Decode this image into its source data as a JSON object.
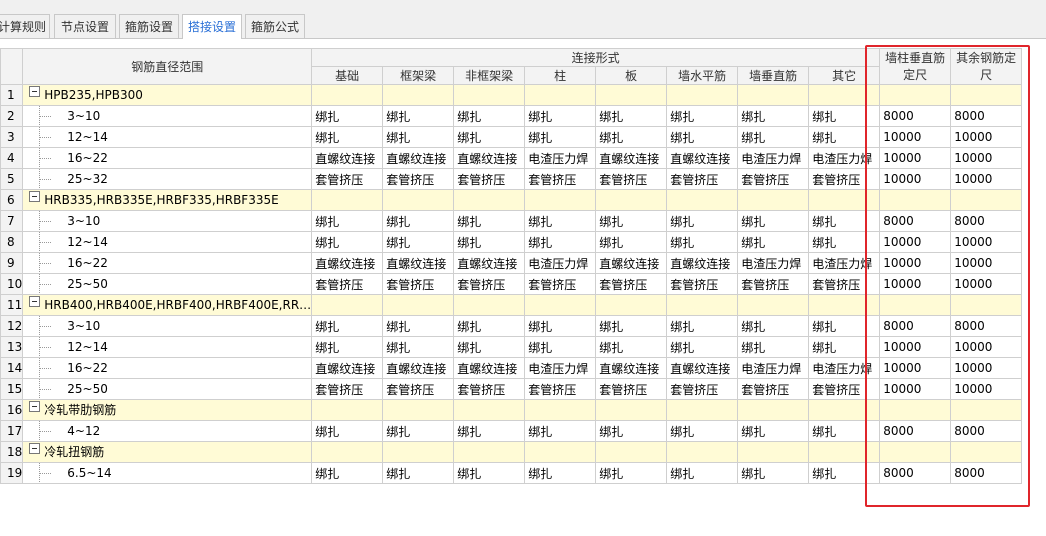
{
  "tabs": [
    {
      "label": "计算规则",
      "active": false
    },
    {
      "label": "节点设置",
      "active": false
    },
    {
      "label": "箍筋设置",
      "active": false
    },
    {
      "label": "搭接设置",
      "active": true
    },
    {
      "label": "箍筋公式",
      "active": false
    }
  ],
  "header": {
    "range": "钢筋直径范围",
    "connection_group": "连接形式",
    "connection_cols": [
      "基础",
      "框架梁",
      "非框架梁",
      "柱",
      "板",
      "墙水平筋",
      "墙垂直筋",
      "其它"
    ],
    "fixed_wall": "墙柱垂直筋定尺",
    "fixed_other": "其余钢筋定尺"
  },
  "rows": [
    {
      "n": "1",
      "type": "cat",
      "label": "HPB235,HPB300"
    },
    {
      "n": "2",
      "type": "data",
      "label": "3~10",
      "c": [
        "绑扎",
        "绑扎",
        "绑扎",
        "绑扎",
        "绑扎",
        "绑扎",
        "绑扎",
        "绑扎"
      ],
      "f1": "8000",
      "f2": "8000"
    },
    {
      "n": "3",
      "type": "data",
      "label": "12~14",
      "c": [
        "绑扎",
        "绑扎",
        "绑扎",
        "绑扎",
        "绑扎",
        "绑扎",
        "绑扎",
        "绑扎"
      ],
      "f1": "10000",
      "f2": "10000"
    },
    {
      "n": "4",
      "type": "data",
      "label": "16~22",
      "c": [
        "直螺纹连接",
        "直螺纹连接",
        "直螺纹连接",
        "电渣压力焊",
        "直螺纹连接",
        "直螺纹连接",
        "电渣压力焊",
        "电渣压力焊"
      ],
      "f1": "10000",
      "f2": "10000"
    },
    {
      "n": "5",
      "type": "data",
      "label": "25~32",
      "c": [
        "套管挤压",
        "套管挤压",
        "套管挤压",
        "套管挤压",
        "套管挤压",
        "套管挤压",
        "套管挤压",
        "套管挤压"
      ],
      "f1": "10000",
      "f2": "10000"
    },
    {
      "n": "6",
      "type": "cat",
      "label": "HRB335,HRB335E,HRBF335,HRBF335E"
    },
    {
      "n": "7",
      "type": "data",
      "label": "3~10",
      "c": [
        "绑扎",
        "绑扎",
        "绑扎",
        "绑扎",
        "绑扎",
        "绑扎",
        "绑扎",
        "绑扎"
      ],
      "f1": "8000",
      "f2": "8000"
    },
    {
      "n": "8",
      "type": "data",
      "label": "12~14",
      "c": [
        "绑扎",
        "绑扎",
        "绑扎",
        "绑扎",
        "绑扎",
        "绑扎",
        "绑扎",
        "绑扎"
      ],
      "f1": "10000",
      "f2": "10000"
    },
    {
      "n": "9",
      "type": "data",
      "label": "16~22",
      "c": [
        "直螺纹连接",
        "直螺纹连接",
        "直螺纹连接",
        "电渣压力焊",
        "直螺纹连接",
        "直螺纹连接",
        "电渣压力焊",
        "电渣压力焊"
      ],
      "f1": "10000",
      "f2": "10000"
    },
    {
      "n": "10",
      "type": "data",
      "label": "25~50",
      "c": [
        "套管挤压",
        "套管挤压",
        "套管挤压",
        "套管挤压",
        "套管挤压",
        "套管挤压",
        "套管挤压",
        "套管挤压"
      ],
      "f1": "10000",
      "f2": "10000"
    },
    {
      "n": "11",
      "type": "cat",
      "label": "HRB400,HRB400E,HRBF400,HRBF400E,RR…"
    },
    {
      "n": "12",
      "type": "data",
      "label": "3~10",
      "c": [
        "绑扎",
        "绑扎",
        "绑扎",
        "绑扎",
        "绑扎",
        "绑扎",
        "绑扎",
        "绑扎"
      ],
      "f1": "8000",
      "f2": "8000"
    },
    {
      "n": "13",
      "type": "data",
      "label": "12~14",
      "c": [
        "绑扎",
        "绑扎",
        "绑扎",
        "绑扎",
        "绑扎",
        "绑扎",
        "绑扎",
        "绑扎"
      ],
      "f1": "10000",
      "f2": "10000"
    },
    {
      "n": "14",
      "type": "data",
      "label": "16~22",
      "c": [
        "直螺纹连接",
        "直螺纹连接",
        "直螺纹连接",
        "电渣压力焊",
        "直螺纹连接",
        "直螺纹连接",
        "电渣压力焊",
        "电渣压力焊"
      ],
      "f1": "10000",
      "f2": "10000"
    },
    {
      "n": "15",
      "type": "data",
      "label": "25~50",
      "c": [
        "套管挤压",
        "套管挤压",
        "套管挤压",
        "套管挤压",
        "套管挤压",
        "套管挤压",
        "套管挤压",
        "套管挤压"
      ],
      "f1": "10000",
      "f2": "10000"
    },
    {
      "n": "16",
      "type": "cat",
      "label": "冷轧带肋钢筋"
    },
    {
      "n": "17",
      "type": "data",
      "label": "4~12",
      "c": [
        "绑扎",
        "绑扎",
        "绑扎",
        "绑扎",
        "绑扎",
        "绑扎",
        "绑扎",
        "绑扎"
      ],
      "f1": "8000",
      "f2": "8000"
    },
    {
      "n": "18",
      "type": "cat",
      "label": "冷轧扭钢筋"
    },
    {
      "n": "19",
      "type": "data",
      "label": "6.5~14",
      "c": [
        "绑扎",
        "绑扎",
        "绑扎",
        "绑扎",
        "绑扎",
        "绑扎",
        "绑扎",
        "绑扎"
      ],
      "f1": "8000",
      "f2": "8000"
    }
  ],
  "colors": {
    "category_bg": "#fffbd6",
    "highlight_border": "#e0252b",
    "active_tab": "#2a6fd6"
  }
}
